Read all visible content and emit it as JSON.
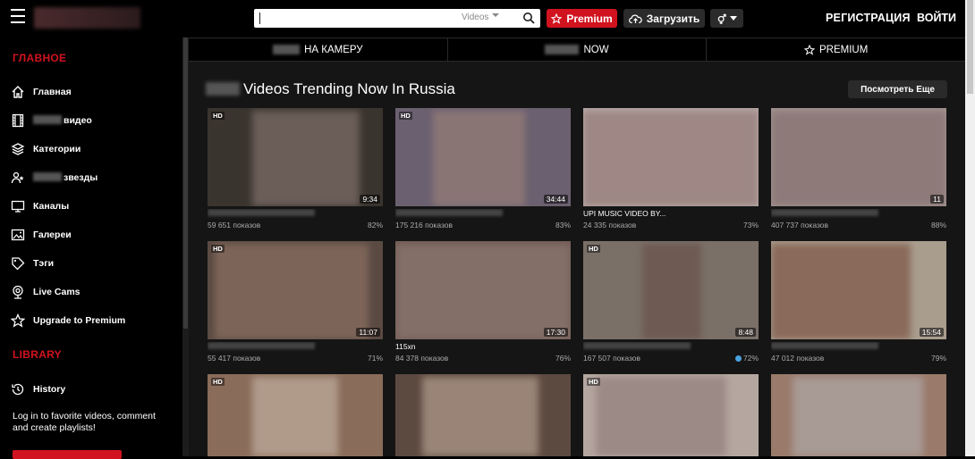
{
  "header": {
    "search_placeholder": "",
    "search_scope": "Videos",
    "premium_label": "Premium",
    "upload_label": "Загрузить",
    "register_label": "РЕГИСТРАЦИЯ",
    "login_label": "ВОЙТИ"
  },
  "sidebar": {
    "main_heading": "ГЛАВНОЕ",
    "items": [
      {
        "label": "Главная",
        "icon": "home-icon"
      },
      {
        "label": "видео",
        "icon": "film-icon"
      },
      {
        "label": "Категории",
        "icon": "layers-icon"
      },
      {
        "label": "звезды",
        "icon": "stars-icon"
      },
      {
        "label": "Каналы",
        "icon": "monitor-icon"
      },
      {
        "label": "Галереи",
        "icon": "image-icon"
      },
      {
        "label": "Тэги",
        "icon": "tag-icon"
      },
      {
        "label": "Live Cams",
        "icon": "webcam-icon"
      },
      {
        "label": "Upgrade to Premium",
        "icon": "star-icon"
      }
    ],
    "library_heading": "LIBRARY",
    "history_label": "History",
    "login_message": "Log in to favorite videos, comment and create playlists!"
  },
  "tabs": [
    {
      "label": "НА КАМЕРУ"
    },
    {
      "label": "NOW"
    },
    {
      "label": "PREMIUM"
    }
  ],
  "section": {
    "title": "Videos Trending Now In Russia",
    "more_label": "Посмотреть Еще"
  },
  "videos": [
    {
      "hd": "HD",
      "duration": "9:34",
      "title": "",
      "views": "59 651 показов",
      "rating": "82%"
    },
    {
      "hd": "HD",
      "duration": "34:44",
      "title": "",
      "views": "175 216 показов",
      "rating": "83%"
    },
    {
      "hd": "",
      "duration": "",
      "title": "UPI  MUSIC VIDEO BY...",
      "views": "24 335 показов",
      "rating": "73%"
    },
    {
      "hd": "",
      "duration": "11",
      "title": "",
      "views": "407 737 показов",
      "rating": "88%"
    },
    {
      "hd": "HD",
      "duration": "11:07",
      "title": "",
      "views": "55 417 показов",
      "rating": "71%"
    },
    {
      "hd": "",
      "duration": "17:30",
      "title": "115xn",
      "views": "84 378 показов",
      "rating": "76%"
    },
    {
      "hd": "HD",
      "duration": "8:48",
      "title": "",
      "views": "167 507 показов",
      "rating": "72%"
    },
    {
      "hd": "",
      "duration": "15:54",
      "title": "",
      "views": "47 012 показов",
      "rating": "79%"
    },
    {
      "hd": "HD",
      "duration": "",
      "title": "",
      "views": "",
      "rating": ""
    },
    {
      "hd": "",
      "duration": "",
      "title": "",
      "views": "",
      "rating": ""
    },
    {
      "hd": "HD",
      "duration": "",
      "title": "",
      "views": "",
      "rating": ""
    },
    {
      "hd": "",
      "duration": "",
      "title": "",
      "views": "",
      "rating": ""
    }
  ]
}
